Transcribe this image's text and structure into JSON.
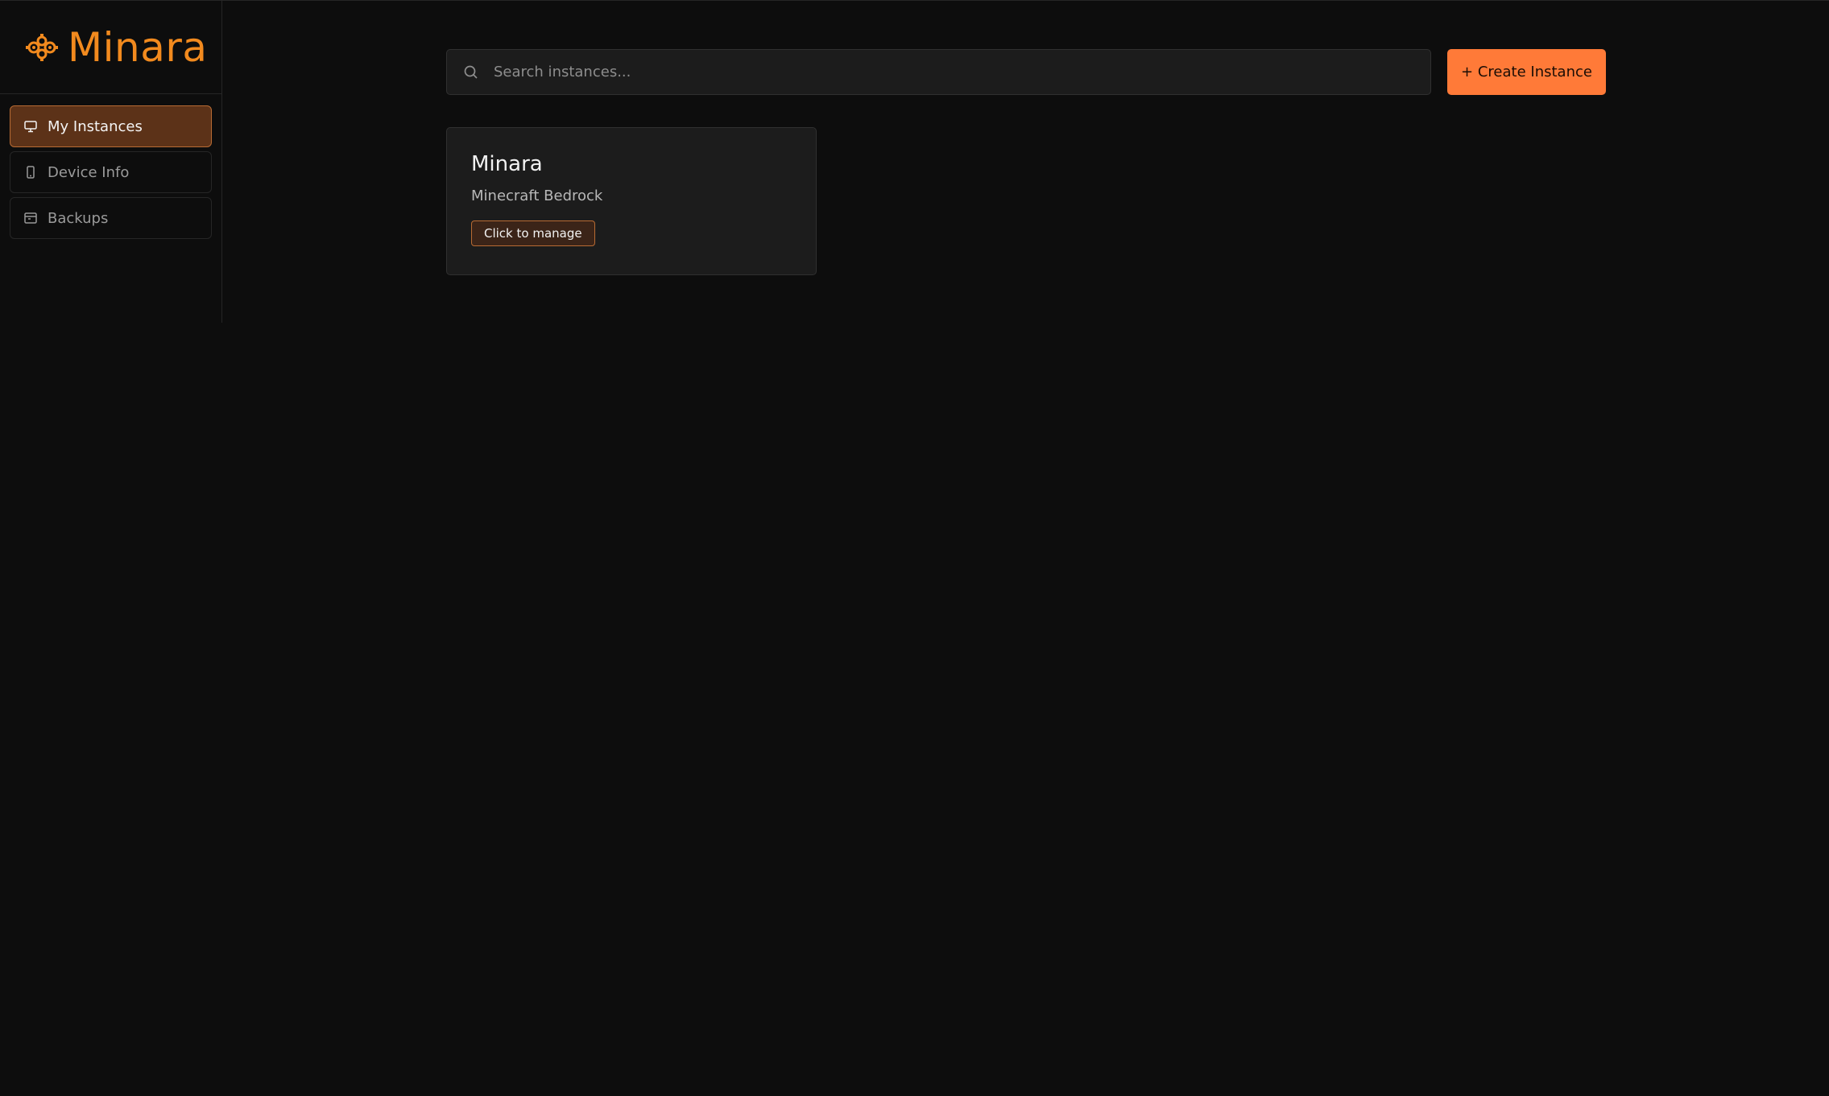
{
  "brand": {
    "name": "Minara",
    "logo_icon": "gear-cluster-icon",
    "color": "#f28a1e"
  },
  "sidebar": {
    "items": [
      {
        "label": "My Instances",
        "icon": "monitor-icon",
        "active": true
      },
      {
        "label": "Device Info",
        "icon": "phone-icon",
        "active": false
      },
      {
        "label": "Backups",
        "icon": "archive-icon",
        "active": false
      }
    ]
  },
  "search": {
    "placeholder": "Search instances...",
    "value": ""
  },
  "toolbar": {
    "create_label": "+ Create Instance",
    "accent": "#ff7a38"
  },
  "instances": [
    {
      "name": "Minara",
      "type": "Minecraft Bedrock",
      "action_label": "Click to manage"
    }
  ]
}
